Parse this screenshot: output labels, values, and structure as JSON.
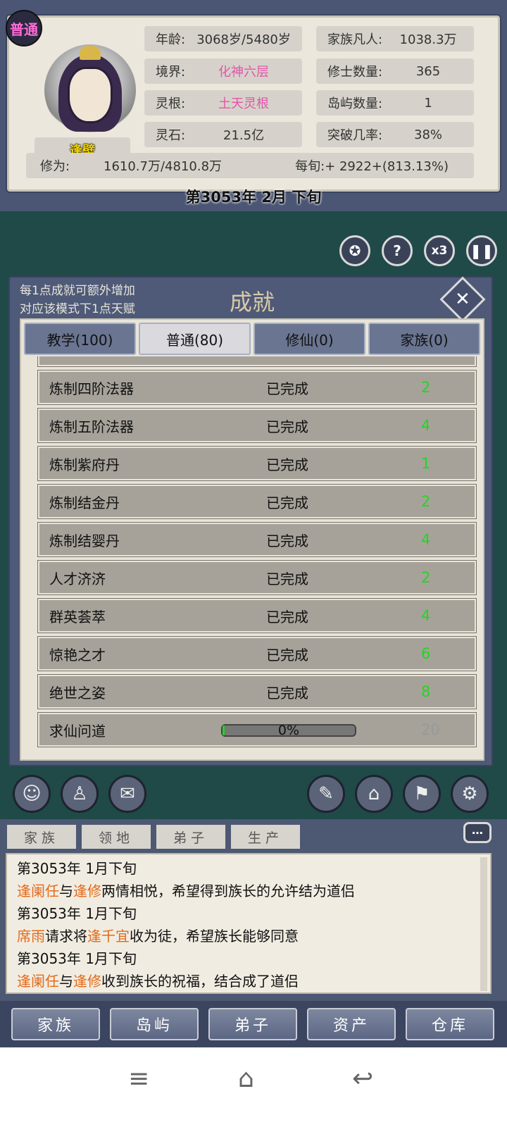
{
  "profile": {
    "mode_badge": "普通",
    "name": "逢壁",
    "age_label": "年龄:",
    "age_value": "3068岁/5480岁",
    "realm_label": "境界:",
    "realm_value": "化神六层",
    "root_label": "灵根:",
    "root_value": "土天灵根",
    "stone_label": "灵石:",
    "stone_value": "21.5亿",
    "mortals_label": "家族凡人:",
    "mortals_value": "1038.3万",
    "cultivators_label": "修士数量:",
    "cultivators_value": "365",
    "islands_label": "岛屿数量:",
    "islands_value": "1",
    "breakthrough_label": "突破几率:",
    "breakthrough_value": "38%",
    "cultivation_label": "修为:",
    "cultivation_value": "1610.7万/4810.8万",
    "per_period": "每旬:+ 2922+(813.13%)"
  },
  "date": "第3053年 2月 下旬",
  "controls": {
    "speed_label": "x3"
  },
  "dialog": {
    "hint_line1": "每1点成就可额外增加",
    "hint_line2": "对应该模式下1点天赋",
    "title": "成就",
    "tabs": [
      "教学(100)",
      "普通(80)",
      "修仙(0)",
      "家族(0)"
    ],
    "active_tab": 1,
    "rows": [
      {
        "name": "炼制四阶法器",
        "status": "已完成",
        "points": "2"
      },
      {
        "name": "炼制五阶法器",
        "status": "已完成",
        "points": "4"
      },
      {
        "name": "炼制紫府丹",
        "status": "已完成",
        "points": "1"
      },
      {
        "name": "炼制结金丹",
        "status": "已完成",
        "points": "2"
      },
      {
        "name": "炼制结婴丹",
        "status": "已完成",
        "points": "4"
      },
      {
        "name": "人才济济",
        "status": "已完成",
        "points": "2"
      },
      {
        "name": "群英荟萃",
        "status": "已完成",
        "points": "4"
      },
      {
        "name": "惊艳之才",
        "status": "已完成",
        "points": "6"
      },
      {
        "name": "绝世之姿",
        "status": "已完成",
        "points": "8"
      }
    ],
    "last_row": {
      "name": "求仙问道",
      "progress_label": "0%",
      "progress": 0.0,
      "points": "20"
    }
  },
  "log_tabs": [
    "家族",
    "领地",
    "弟子",
    "生产"
  ],
  "log": [
    {
      "date": "第3053年 1月下旬",
      "a": "逢阑任",
      "m1": "与",
      "b": "逢修",
      "m2": "两情相悦，希望得到族长的允许结为道侣"
    },
    {
      "date": "第3053年 1月下旬",
      "a": "席雨",
      "m1": "请求将",
      "b": "逢千宜",
      "m2": "收为徒，希望族长能够同意"
    },
    {
      "date": "第3053年 1月下旬",
      "a": "逢阑任",
      "m1": "与",
      "b": "逢修",
      "m2": "收到族长的祝福，结合成了道侣"
    }
  ],
  "nav": [
    "家族",
    "岛屿",
    "弟子",
    "资产",
    "仓库"
  ]
}
